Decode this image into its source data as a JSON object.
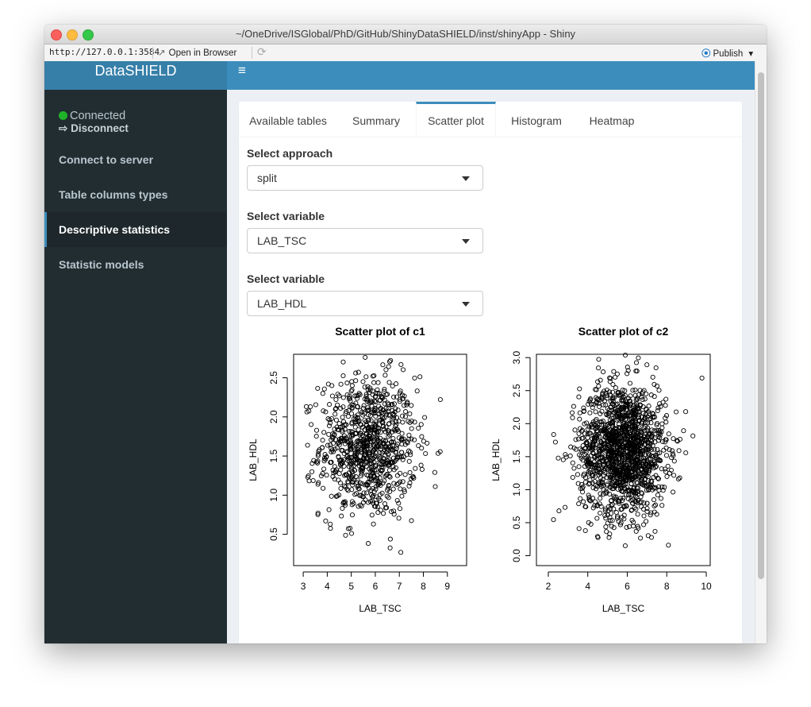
{
  "window": {
    "title": "~/OneDrive/ISGlobal/PhD/GitHub/ShinyDataSHIELD/inst/shinyApp - Shiny",
    "url": "http://127.0.0.1:3584",
    "open_in_browser": "Open in Browser",
    "publish": "Publish",
    "publish_caret": "▾",
    "open_icon": "↗",
    "refresh_icon": "⟳"
  },
  "app": {
    "brand": "DataSHIELD",
    "menu_icon": "≡",
    "status": {
      "connected": "Connected",
      "disconnect": "Disconnect",
      "disconnect_icon": "⇨",
      "status_color": "#1fb328"
    },
    "sidebar": {
      "items": [
        {
          "label": "Connect to server"
        },
        {
          "label": "Table columns types"
        },
        {
          "label": "Descriptive statistics"
        },
        {
          "label": "Statistic models"
        }
      ],
      "active_index": 2
    },
    "tabs": [
      {
        "label": "Available tables"
      },
      {
        "label": "Summary"
      },
      {
        "label": "Scatter plot"
      },
      {
        "label": "Histogram"
      },
      {
        "label": "Heatmap"
      }
    ],
    "active_tab": 2,
    "form": {
      "approach_label": "Select approach",
      "approach_value": "split",
      "var1_label": "Select variable",
      "var1_value": "LAB_TSC",
      "var2_label": "Select variable",
      "var2_value": "LAB_HDL"
    },
    "colors": {
      "accent": "#3c8dbc",
      "sidebar_bg": "#222d32",
      "header_bg": "#3c8dbc"
    }
  },
  "chart_data": [
    {
      "type": "scatter",
      "title": "Scatter plot of c1",
      "xlabel": "LAB_TSC",
      "ylabel": "LAB_HDL",
      "xlim": [
        2.6,
        9.8
      ],
      "ylim": [
        0.1,
        2.8
      ],
      "xticks": [
        3,
        4,
        5,
        6,
        7,
        8,
        9
      ],
      "yticks": [
        0.5,
        1.0,
        1.5,
        2.0,
        2.5
      ],
      "grid": false,
      "points_estimated": {
        "n": 900,
        "x_center": 5.7,
        "x_sd": 1.0,
        "y_center": 1.62,
        "y_sd": 0.45
      }
    },
    {
      "type": "scatter",
      "title": "Scatter plot of c2",
      "xlabel": "LAB_TSC",
      "ylabel": "LAB_HDL",
      "xlim": [
        1.4,
        10.2
      ],
      "ylim": [
        -0.15,
        3.05
      ],
      "xticks": [
        2,
        4,
        6,
        8,
        10
      ],
      "yticks": [
        0.0,
        0.5,
        1.0,
        1.5,
        2.0,
        2.5,
        3.0
      ],
      "grid": false,
      "points_estimated": {
        "n": 1500,
        "x_center": 5.8,
        "x_sd": 1.1,
        "y_center": 1.6,
        "y_sd": 0.5
      }
    }
  ]
}
